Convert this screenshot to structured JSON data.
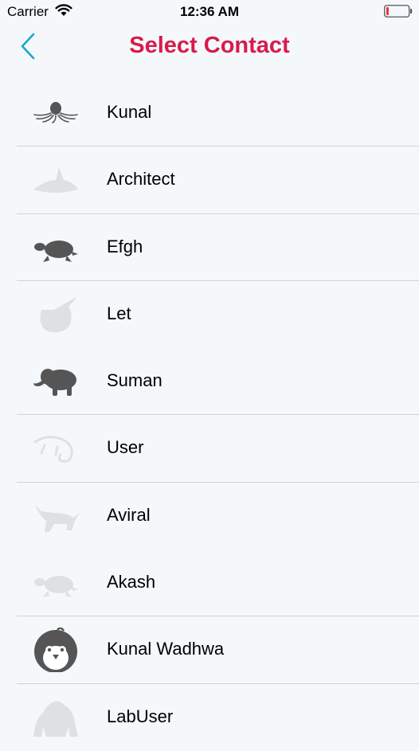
{
  "status_bar": {
    "carrier": "Carrier",
    "time": "12:36 AM",
    "wifi_icon": "wifi-icon",
    "battery_icon": "battery-low-icon",
    "battery_color": "#e53935"
  },
  "nav": {
    "back_icon": "chevron-left-icon",
    "title": "Select Contact",
    "title_color": "#d81b4c",
    "back_color": "#1aa8c8"
  },
  "contacts": [
    {
      "name": "Kunal",
      "avatar_icon": "octopus-icon",
      "avatar_faded": false
    },
    {
      "name": "Architect",
      "avatar_icon": "shark-icon",
      "avatar_faded": true
    },
    {
      "name": "Efgh",
      "avatar_icon": "turtle-icon",
      "avatar_faded": false
    },
    {
      "name": "Let",
      "avatar_icon": "whale-icon",
      "avatar_faded": true
    },
    {
      "name": "Suman",
      "avatar_icon": "elephant-icon",
      "avatar_faded": false
    },
    {
      "name": "User",
      "avatar_icon": "chameleon-icon",
      "avatar_faded": true
    },
    {
      "name": "Aviral",
      "avatar_icon": "wolf-icon",
      "avatar_faded": true
    },
    {
      "name": "Akash",
      "avatar_icon": "turtle-icon",
      "avatar_faded": true
    },
    {
      "name": "Kunal Wadhwa",
      "avatar_icon": "penguin-icon",
      "avatar_faded": false
    },
    {
      "name": "LabUser",
      "avatar_icon": "gorilla-icon",
      "avatar_faded": true
    }
  ]
}
